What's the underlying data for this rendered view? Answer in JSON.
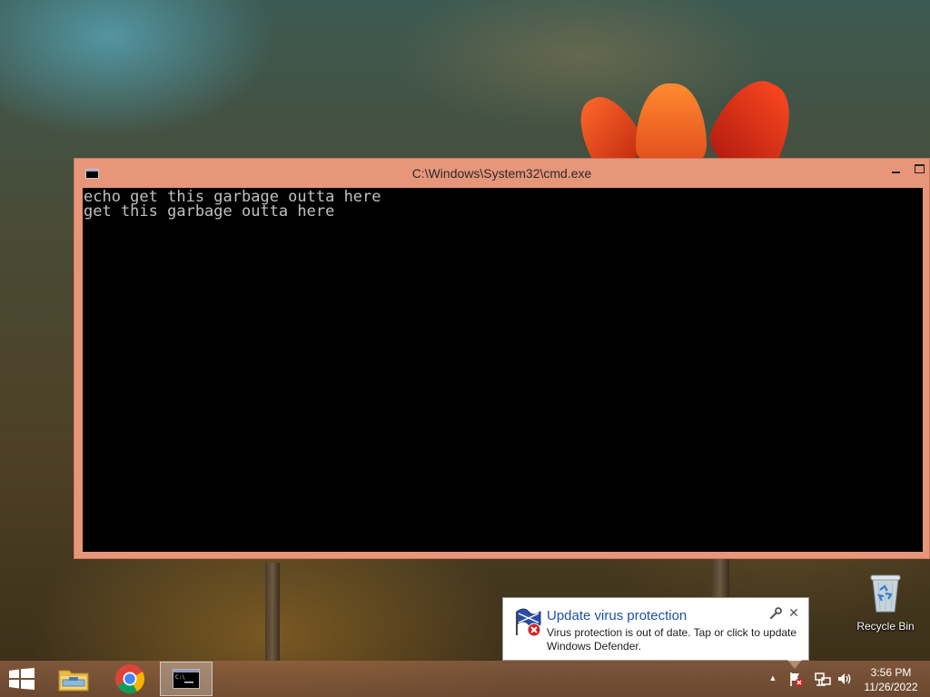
{
  "window": {
    "title": "C:\\Windows\\System32\\cmd.exe",
    "console_lines": [
      "echo get this garbage outta here",
      "get this garbage outta here"
    ]
  },
  "desktop": {
    "recycle_bin_label": "Recycle Bin"
  },
  "notification": {
    "title": "Update virus protection",
    "body": "Virus protection is out of date. Tap or click to update Windows Defender.",
    "icons": [
      "defender-icon",
      "wrench-icon",
      "close-icon"
    ]
  },
  "taskbar": {
    "items": [
      {
        "name": "start-button",
        "icon": "windows-logo-icon"
      },
      {
        "name": "file-explorer-button",
        "icon": "folder-icon"
      },
      {
        "name": "chrome-button",
        "icon": "chrome-icon"
      },
      {
        "name": "cmd-button",
        "icon": "cmd-icon",
        "active": true
      }
    ],
    "tray_icons": [
      "show-hidden-icons-arrow",
      "action-center-flag-icon",
      "network-icon",
      "volume-icon"
    ],
    "clock": {
      "time": "3:56 PM",
      "date": "11/26/2022"
    }
  },
  "colors": {
    "window_frame": "#e8967a",
    "console_bg": "#000000",
    "console_text": "#c0c0c0",
    "notification_title": "#1c52a8"
  }
}
